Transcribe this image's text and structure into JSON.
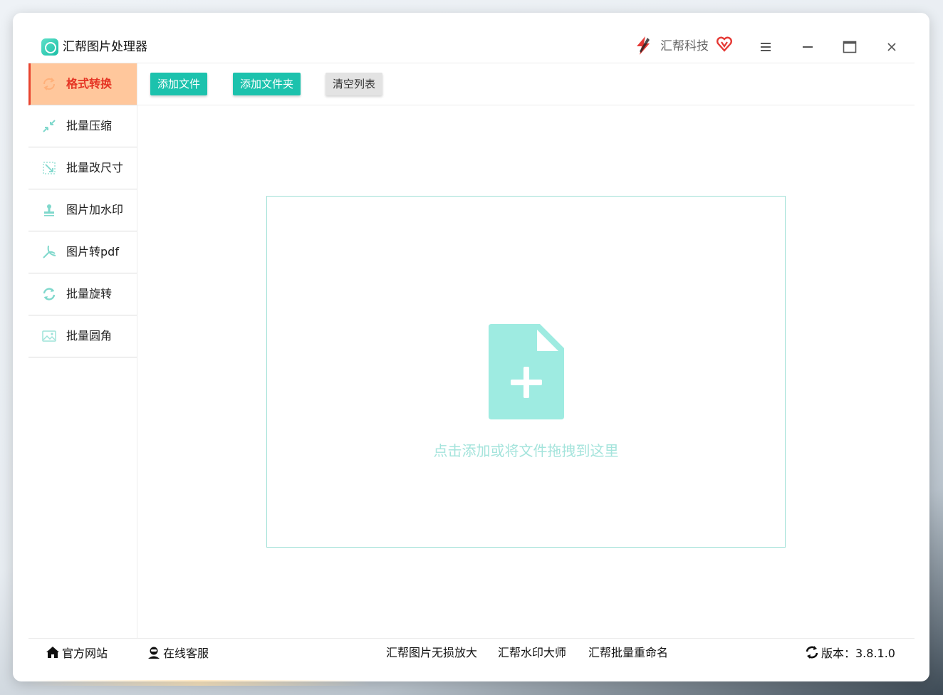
{
  "app": {
    "title": "汇帮图片处理器",
    "brand": "汇帮科技",
    "accent": "#1cc2ad",
    "active_color": "#e53323"
  },
  "window_controls": {
    "icons": [
      "menu-icon",
      "minimize-icon",
      "maximize-icon",
      "close-icon"
    ]
  },
  "sidebar": {
    "items": [
      {
        "label": "格式转换",
        "icon": "convert-icon",
        "active": true
      },
      {
        "label": "批量压缩",
        "icon": "compress-icon"
      },
      {
        "label": "批量改尺寸",
        "icon": "resize-icon"
      },
      {
        "label": "图片加水印",
        "icon": "stamp-icon"
      },
      {
        "label": "图片转pdf",
        "icon": "pdf-icon"
      },
      {
        "label": "批量旋转",
        "icon": "rotate-icon"
      },
      {
        "label": "批量圆角",
        "icon": "image-icon"
      }
    ]
  },
  "toolbar": {
    "add_file": "添加文件",
    "add_folder": "添加文件夹",
    "clear_list": "清空列表"
  },
  "dropzone": {
    "hint": "点击添加或将文件拖拽到这里"
  },
  "footer": {
    "official_site": "官方网站",
    "online_support": "在线客服",
    "links": [
      "汇帮图片无损放大",
      "汇帮水印大师",
      "汇帮批量重命名"
    ],
    "version": "版本：3.8.1.0"
  }
}
